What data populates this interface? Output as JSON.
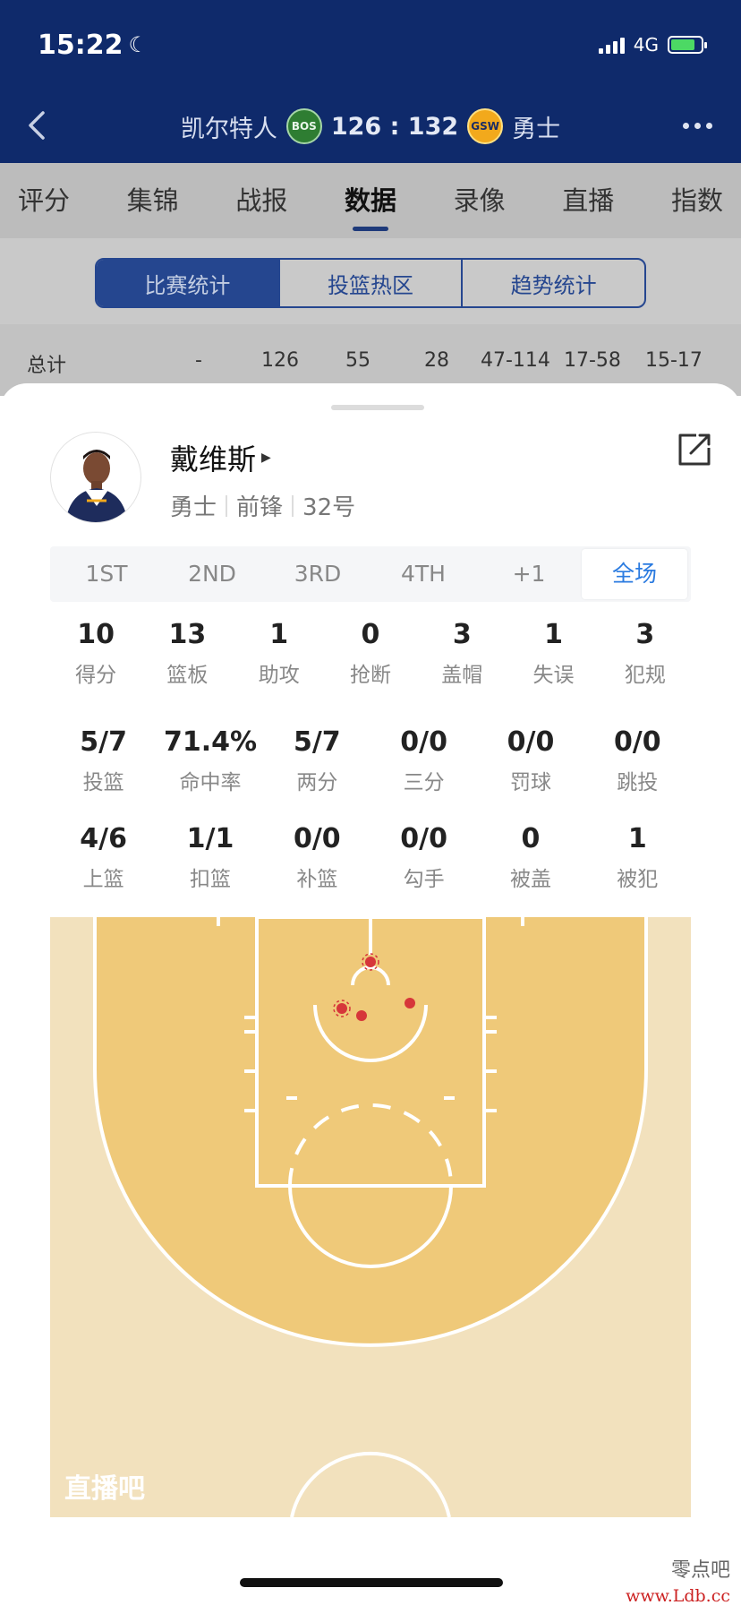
{
  "status_bar": {
    "time": "15:22",
    "network": "4G"
  },
  "game": {
    "home_team": "凯尔特人",
    "home_abbr": "BOS",
    "score": "126 : 132",
    "away_abbr": "GSW",
    "away_team": "勇士"
  },
  "nav_tabs": [
    "评分",
    "集锦",
    "战报",
    "数据",
    "录像",
    "直播",
    "指数"
  ],
  "active_nav": "数据",
  "segments": [
    "比赛统计",
    "投篮热区",
    "趋势统计"
  ],
  "totals_row": {
    "label": "总计",
    "cols": [
      "-",
      "126",
      "55",
      "28",
      "47-114",
      "17-58",
      "15-17"
    ]
  },
  "player": {
    "name": "戴维斯",
    "team": "勇士",
    "position": "前锋",
    "number": "32号"
  },
  "quarters": [
    "1ST",
    "2ND",
    "3RD",
    "4TH",
    "+1",
    "全场"
  ],
  "stats_row1": [
    {
      "value": "10",
      "label": "得分"
    },
    {
      "value": "13",
      "label": "篮板"
    },
    {
      "value": "1",
      "label": "助攻"
    },
    {
      "value": "0",
      "label": "抢断"
    },
    {
      "value": "3",
      "label": "盖帽"
    },
    {
      "value": "1",
      "label": "失误"
    },
    {
      "value": "3",
      "label": "犯规"
    }
  ],
  "stats_row2": [
    {
      "value": "5/7",
      "label": "投篮"
    },
    {
      "value": "71.4%",
      "label": "命中率"
    },
    {
      "value": "5/7",
      "label": "两分"
    },
    {
      "value": "0/0",
      "label": "三分"
    },
    {
      "value": "0/0",
      "label": "罚球"
    },
    {
      "value": "0/0",
      "label": "跳投"
    }
  ],
  "stats_row3": [
    {
      "value": "4/6",
      "label": "上篮"
    },
    {
      "value": "1/1",
      "label": "扣篮"
    },
    {
      "value": "0/0",
      "label": "补篮"
    },
    {
      "value": "0/0",
      "label": "勾手"
    },
    {
      "value": "0",
      "label": "被盖"
    },
    {
      "value": "1",
      "label": "被犯"
    }
  ],
  "court": {
    "watermark": "直播吧",
    "colors": {
      "inner": "#efc979",
      "outer": "#f2e1bd",
      "made": "#d6363a"
    }
  },
  "corner_watermark": {
    "text": "零点吧",
    "url": "www.Ldb.cc"
  }
}
